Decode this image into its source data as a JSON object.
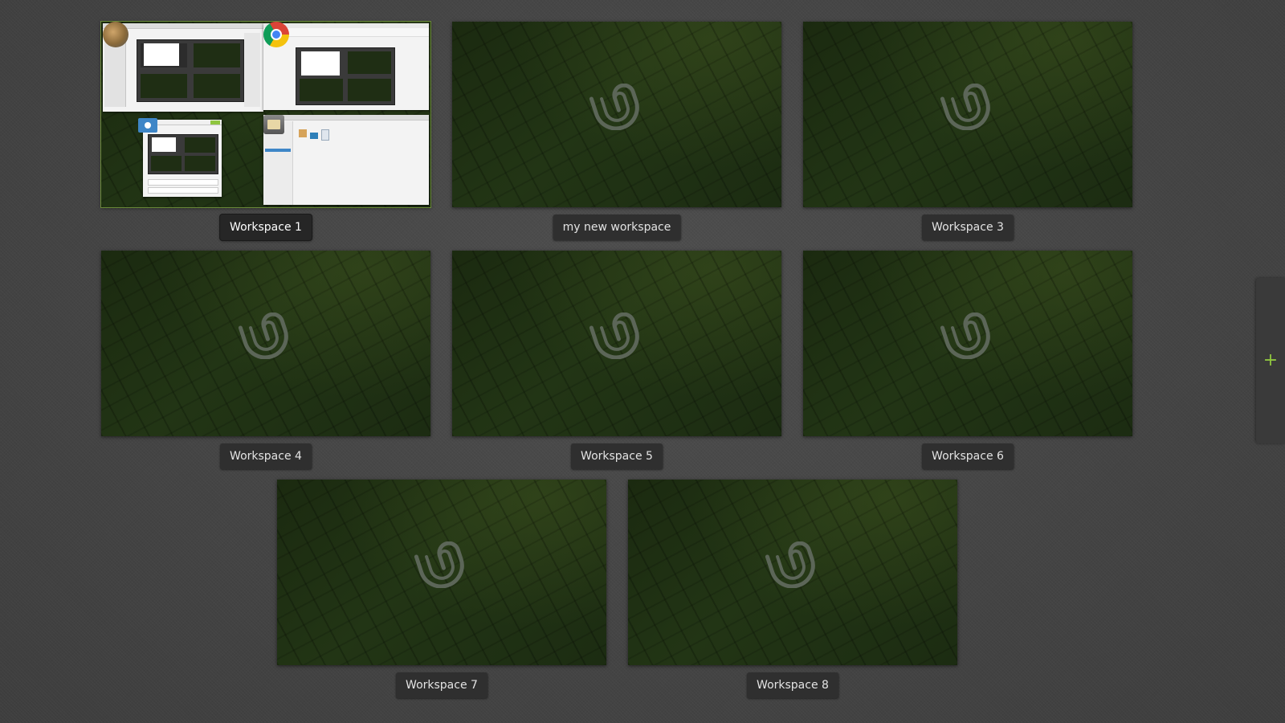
{
  "workspaces": [
    {
      "label": "Workspace 1",
      "active": true
    },
    {
      "label": "my new workspace",
      "active": false
    },
    {
      "label": "Workspace 3",
      "active": false
    },
    {
      "label": "Workspace 4",
      "active": false
    },
    {
      "label": "Workspace 5",
      "active": false
    },
    {
      "label": "Workspace 6",
      "active": false
    },
    {
      "label": "Workspace 7",
      "active": false
    },
    {
      "label": "Workspace 8",
      "active": false
    }
  ],
  "add_workspace": {
    "label": "+",
    "icon": "plus-icon",
    "color": "#8fc53f"
  },
  "workspace1_windows": [
    {
      "app": "GIMP",
      "icon": "gimp-icon"
    },
    {
      "app": "Google Chrome",
      "icon": "chrome-icon"
    },
    {
      "app": "Screenshot",
      "icon": "camera-icon"
    },
    {
      "app": "File Manager",
      "icon": "file-manager-icon"
    }
  ],
  "colors": {
    "background": "#474747",
    "label_bg": "#2f2f2f",
    "wallpaper": "#1f2e14",
    "accent": "#8fc53f"
  }
}
